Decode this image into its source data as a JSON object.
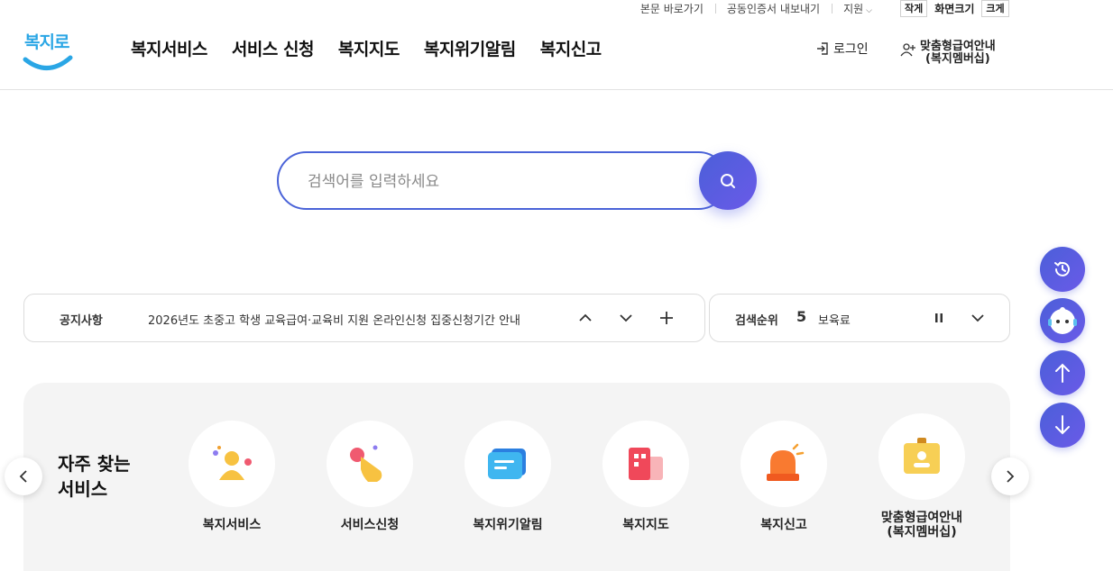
{
  "utility": {
    "links": [
      {
        "label": "본문 바로가기"
      },
      {
        "label": "공동인증서 내보내기"
      },
      {
        "label": "지원"
      }
    ],
    "font_small": "작게",
    "font_label": "화면크기",
    "font_large": "크게"
  },
  "header": {
    "logo_text": "복지로",
    "nav": [
      "복지서비스",
      "서비스 신청",
      "복지지도",
      "복지위기알림",
      "복지신고"
    ],
    "login_label": "로그인",
    "member_label_1": "맞춤형급여안내",
    "member_label_2": "(복지멤버십)"
  },
  "search": {
    "placeholder": "검색어를 입력하세요"
  },
  "notice": {
    "label": "공지사항",
    "text": "2026년도 초중고 학생 교육급여·교육비 지원 온라인신청 집중신청기간 안내"
  },
  "rank": {
    "label": "검색순위",
    "number": "5",
    "keyword": "보육료"
  },
  "services": {
    "title_line1": "자주 찾는",
    "title_line2": "서비스",
    "items": [
      {
        "label": "복지서비스",
        "icon": "person-icon"
      },
      {
        "label": "서비스신청",
        "icon": "hand-click-icon"
      },
      {
        "label": "복지위기알림",
        "icon": "message-icon"
      },
      {
        "label": "복지지도",
        "icon": "building-map-icon"
      },
      {
        "label": "복지신고",
        "icon": "siren-icon"
      },
      {
        "label": "맞춤형급여안내\n(복지멤버십)",
        "label_1": "맞춤형급여안내",
        "label_2": "(복지멤버십)",
        "icon": "id-badge-icon"
      }
    ]
  },
  "colors": {
    "brand_blue": "#4a63d8",
    "brand_purple": "#6a5ae8",
    "logo_cyan": "#2aa6e5"
  }
}
